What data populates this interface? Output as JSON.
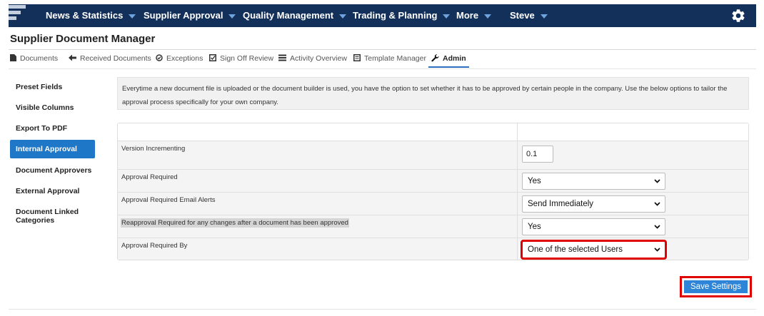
{
  "topnav": {
    "items": [
      {
        "label": "News & Statistics"
      },
      {
        "label": "Supplier Approval"
      },
      {
        "label": "Quality Management"
      },
      {
        "label": "Trading & Planning"
      },
      {
        "label": "More"
      },
      {
        "label": "Steve"
      }
    ],
    "colors": {
      "bar": "#13305b",
      "caret": "#6fa3de"
    }
  },
  "page": {
    "title": "Supplier Document Manager"
  },
  "tabs": [
    {
      "label": "Documents",
      "icon": "document-icon"
    },
    {
      "label": "Received Documents",
      "icon": "arrow-left-icon"
    },
    {
      "label": "Exceptions",
      "icon": "check-circle-icon"
    },
    {
      "label": "Sign Off Review",
      "icon": "check-square-icon"
    },
    {
      "label": "Activity Overview",
      "icon": "list-icon"
    },
    {
      "label": "Template Manager",
      "icon": "template-icon"
    },
    {
      "label": "Admin",
      "icon": "wrench-icon",
      "active": true
    }
  ],
  "sidebar": {
    "items": [
      {
        "label": "Preset Fields"
      },
      {
        "label": "Visible Columns"
      },
      {
        "label": "Export To PDF"
      },
      {
        "label": "Internal Approval",
        "active": true
      },
      {
        "label": "Document Approvers"
      },
      {
        "label": "External Approval"
      },
      {
        "label": "Document Linked Categories"
      }
    ],
    "active_color": "#1f77c8"
  },
  "info": {
    "text": "Everytime a new document file is uploaded or the document builder is used, you have the option to set whether it has to be approved by certain people in the company. Use the below options to tailor the approval process specifically for your own company."
  },
  "settings": {
    "version_incrementing": {
      "label": "Version Incrementing",
      "value": "0.1"
    },
    "approval_required": {
      "label": "Approval Required",
      "value": "Yes"
    },
    "email_alerts": {
      "label": "Approval Required Email Alerts",
      "value": "Send Immediately"
    },
    "reapproval_required": {
      "label": "Reapproval Required for any changes after a document has been approved",
      "value": "Yes"
    },
    "approval_required_by": {
      "label": "Approval Required By",
      "value": "One of the selected Users"
    }
  },
  "actions": {
    "save_label": "Save Settings",
    "save_color": "#2e84d6",
    "highlight_color": "#e00000"
  }
}
